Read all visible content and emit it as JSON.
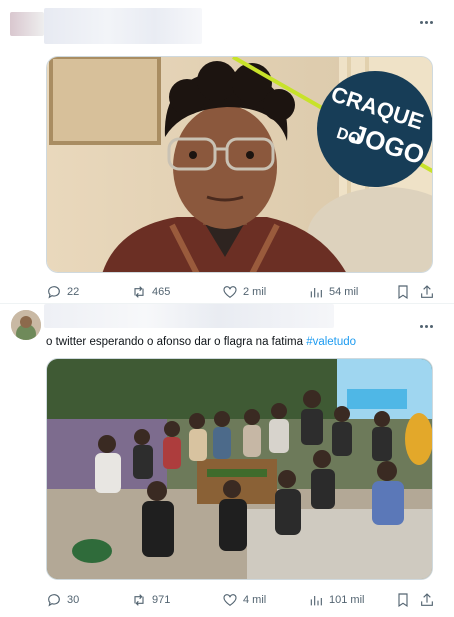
{
  "tweets": [
    {
      "image_badge": {
        "line1": "CRAQUE",
        "line2": "DO",
        "line3": "JOGO"
      },
      "actions": {
        "replies": "22",
        "retweets": "465",
        "likes": "2 mil",
        "views": "54 mil"
      }
    },
    {
      "text": "o twitter esperando o afonso dar o flagra na fatima ",
      "hashtag": "#valetudo",
      "actions": {
        "replies": "30",
        "retweets": "971",
        "likes": "4 mil",
        "views": "101 mil"
      }
    }
  ],
  "colors": {
    "accent": "#1d9bf0",
    "badge_bg": "#173d57",
    "badge_line": "#c8e22a",
    "icon": "#536471"
  },
  "icons": [
    "more-icon",
    "reply-icon",
    "retweet-icon",
    "like-icon",
    "views-icon",
    "bookmark-icon",
    "share-icon"
  ]
}
